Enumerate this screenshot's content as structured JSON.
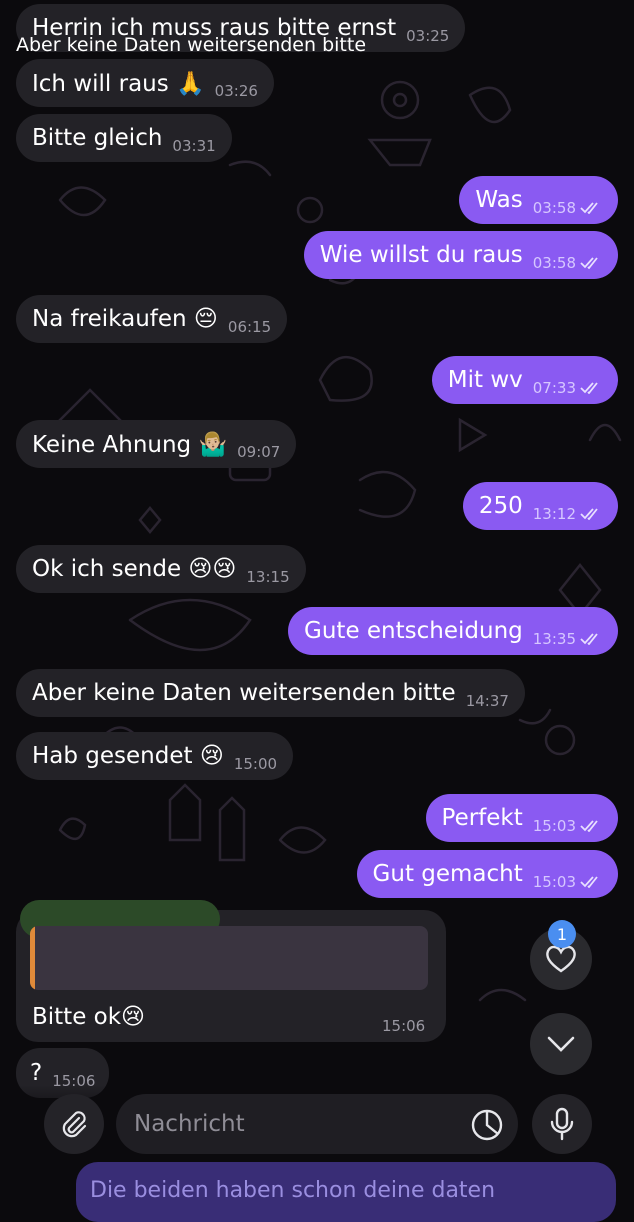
{
  "messages": [
    {
      "dir": "in",
      "text": "Herrin ich muss raus bitte ernst",
      "time": "03:25"
    },
    {
      "dir": "in",
      "text": "Ich will raus 🙏",
      "time": "03:26"
    },
    {
      "dir": "in",
      "text": "Bitte gleich",
      "time": "03:31"
    },
    {
      "dir": "out",
      "text": "Was",
      "time": "03:58"
    },
    {
      "dir": "out",
      "text": "Wie willst du raus",
      "time": "03:58"
    },
    {
      "dir": "in",
      "text": "Na freikaufen 😔",
      "time": "06:15"
    },
    {
      "dir": "out",
      "text": "Mit wv",
      "time": "07:33"
    },
    {
      "dir": "in",
      "text": "Keine Ahnung 🤷🏼‍♂️",
      "time": "09:07"
    },
    {
      "dir": "out",
      "text": "250",
      "time": "13:12"
    },
    {
      "dir": "in",
      "text": "Ok ich sende 😢😢",
      "time": "13:15"
    },
    {
      "dir": "out",
      "text": "Gute entscheidung",
      "time": "13:35"
    },
    {
      "dir": "in",
      "text": "Aber keine Daten weitersenden bitte",
      "time": "14:37"
    },
    {
      "dir": "in",
      "text": "Hab gesendet 😢",
      "time": "15:00"
    },
    {
      "dir": "out",
      "text": "Perfekt",
      "time": "15:03"
    },
    {
      "dir": "out",
      "text": "Gut gemacht",
      "time": "15:03"
    }
  ],
  "reply_message": {
    "quoted_text": "Aber keine Daten weitersenden bitte",
    "text": "Bitte ok😢",
    "time": "15:06"
  },
  "last_message": {
    "text": "?",
    "time": "15:06"
  },
  "reactions_badge": "1",
  "composer": {
    "placeholder": "Nachricht"
  },
  "peek_message": "Die beiden haben schon deine daten",
  "colors": {
    "outgoing": "#8a5af2",
    "incoming": "#232227",
    "background": "#0b0a0d"
  },
  "icons": [
    "paperclip-icon",
    "sticker-icon",
    "microphone-icon",
    "heart-icon",
    "chevron-down-icon",
    "double-check-icon"
  ]
}
